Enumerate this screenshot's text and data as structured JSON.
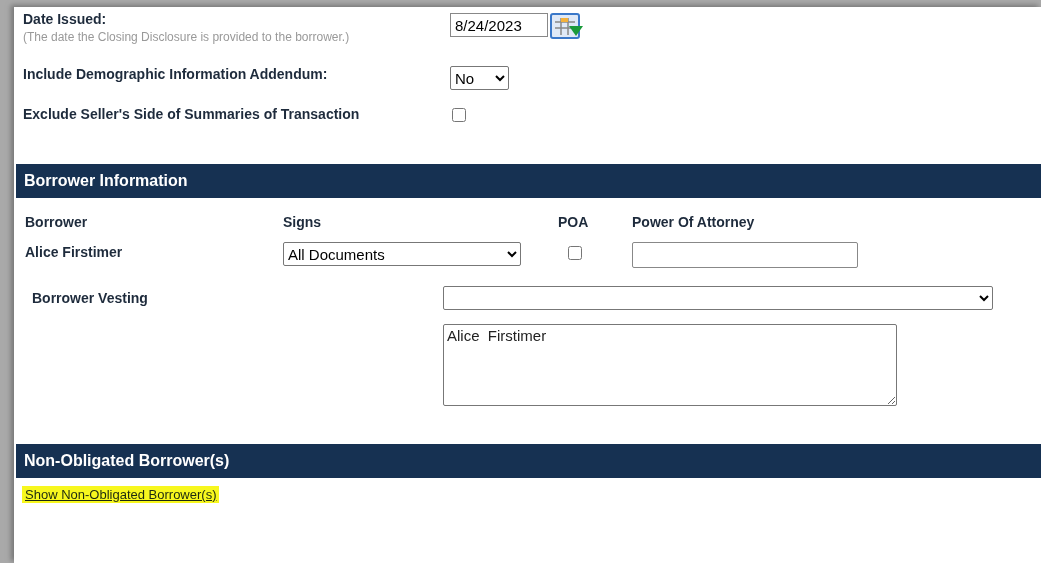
{
  "settings": [
    {
      "kind": "date",
      "label": "Date Issued:",
      "hint": "(The date the Closing Disclosure is provided to the borrower.)",
      "value": "8/24/2023"
    },
    {
      "kind": "select",
      "label": "Include Demographic Information Addendum:",
      "value": "No"
    },
    {
      "kind": "checkbox",
      "label": "Exclude Seller's Side of Summaries of Transaction",
      "checked": false
    }
  ],
  "borrower_information": {
    "title": "Borrower Information",
    "columns": [
      "Borrower",
      "Signs",
      "POA",
      "Power Of Attorney"
    ],
    "rows": [
      {
        "borrower": "Alice Firstimer",
        "signs": "All Documents",
        "poa": false,
        "power_of_attorney": ""
      }
    ],
    "vesting": {
      "label": "Borrower Vesting",
      "text": "Alice  Firstimer"
    }
  },
  "non_obligated": {
    "title": "Non-Obligated Borrower(s)",
    "link": "Show Non-Obligated Borrower(s)",
    "highlighted": true
  }
}
